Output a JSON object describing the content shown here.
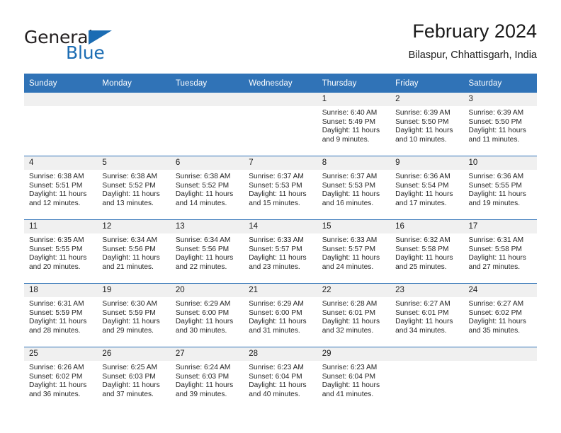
{
  "brand": {
    "name_top": "General",
    "name_bottom": "Blue",
    "accent_color": "#1b6cb3"
  },
  "header": {
    "title": "February 2024",
    "location": "Bilaspur, Chhattisgarh, India"
  },
  "theme": {
    "header_blue": "#3073b7",
    "daynum_band": "#f0f0f0",
    "text": "#1a1a1a"
  },
  "calendar": {
    "weekdays": [
      "Sunday",
      "Monday",
      "Tuesday",
      "Wednesday",
      "Thursday",
      "Friday",
      "Saturday"
    ],
    "labels": {
      "sunrise": "Sunrise:",
      "sunset": "Sunset:",
      "daylight": "Daylight:"
    },
    "weeks": [
      [
        {
          "day": "",
          "empty": true
        },
        {
          "day": "",
          "empty": true
        },
        {
          "day": "",
          "empty": true
        },
        {
          "day": "",
          "empty": true
        },
        {
          "day": "1",
          "sunrise": "Sunrise: 6:40 AM",
          "sunset": "Sunset: 5:49 PM",
          "daylight1": "Daylight: 11 hours",
          "daylight2": "and 9 minutes."
        },
        {
          "day": "2",
          "sunrise": "Sunrise: 6:39 AM",
          "sunset": "Sunset: 5:50 PM",
          "daylight1": "Daylight: 11 hours",
          "daylight2": "and 10 minutes."
        },
        {
          "day": "3",
          "sunrise": "Sunrise: 6:39 AM",
          "sunset": "Sunset: 5:50 PM",
          "daylight1": "Daylight: 11 hours",
          "daylight2": "and 11 minutes."
        }
      ],
      [
        {
          "day": "4",
          "sunrise": "Sunrise: 6:38 AM",
          "sunset": "Sunset: 5:51 PM",
          "daylight1": "Daylight: 11 hours",
          "daylight2": "and 12 minutes."
        },
        {
          "day": "5",
          "sunrise": "Sunrise: 6:38 AM",
          "sunset": "Sunset: 5:52 PM",
          "daylight1": "Daylight: 11 hours",
          "daylight2": "and 13 minutes."
        },
        {
          "day": "6",
          "sunrise": "Sunrise: 6:38 AM",
          "sunset": "Sunset: 5:52 PM",
          "daylight1": "Daylight: 11 hours",
          "daylight2": "and 14 minutes."
        },
        {
          "day": "7",
          "sunrise": "Sunrise: 6:37 AM",
          "sunset": "Sunset: 5:53 PM",
          "daylight1": "Daylight: 11 hours",
          "daylight2": "and 15 minutes."
        },
        {
          "day": "8",
          "sunrise": "Sunrise: 6:37 AM",
          "sunset": "Sunset: 5:53 PM",
          "daylight1": "Daylight: 11 hours",
          "daylight2": "and 16 minutes."
        },
        {
          "day": "9",
          "sunrise": "Sunrise: 6:36 AM",
          "sunset": "Sunset: 5:54 PM",
          "daylight1": "Daylight: 11 hours",
          "daylight2": "and 17 minutes."
        },
        {
          "day": "10",
          "sunrise": "Sunrise: 6:36 AM",
          "sunset": "Sunset: 5:55 PM",
          "daylight1": "Daylight: 11 hours",
          "daylight2": "and 19 minutes."
        }
      ],
      [
        {
          "day": "11",
          "sunrise": "Sunrise: 6:35 AM",
          "sunset": "Sunset: 5:55 PM",
          "daylight1": "Daylight: 11 hours",
          "daylight2": "and 20 minutes."
        },
        {
          "day": "12",
          "sunrise": "Sunrise: 6:34 AM",
          "sunset": "Sunset: 5:56 PM",
          "daylight1": "Daylight: 11 hours",
          "daylight2": "and 21 minutes."
        },
        {
          "day": "13",
          "sunrise": "Sunrise: 6:34 AM",
          "sunset": "Sunset: 5:56 PM",
          "daylight1": "Daylight: 11 hours",
          "daylight2": "and 22 minutes."
        },
        {
          "day": "14",
          "sunrise": "Sunrise: 6:33 AM",
          "sunset": "Sunset: 5:57 PM",
          "daylight1": "Daylight: 11 hours",
          "daylight2": "and 23 minutes."
        },
        {
          "day": "15",
          "sunrise": "Sunrise: 6:33 AM",
          "sunset": "Sunset: 5:57 PM",
          "daylight1": "Daylight: 11 hours",
          "daylight2": "and 24 minutes."
        },
        {
          "day": "16",
          "sunrise": "Sunrise: 6:32 AM",
          "sunset": "Sunset: 5:58 PM",
          "daylight1": "Daylight: 11 hours",
          "daylight2": "and 25 minutes."
        },
        {
          "day": "17",
          "sunrise": "Sunrise: 6:31 AM",
          "sunset": "Sunset: 5:58 PM",
          "daylight1": "Daylight: 11 hours",
          "daylight2": "and 27 minutes."
        }
      ],
      [
        {
          "day": "18",
          "sunrise": "Sunrise: 6:31 AM",
          "sunset": "Sunset: 5:59 PM",
          "daylight1": "Daylight: 11 hours",
          "daylight2": "and 28 minutes."
        },
        {
          "day": "19",
          "sunrise": "Sunrise: 6:30 AM",
          "sunset": "Sunset: 5:59 PM",
          "daylight1": "Daylight: 11 hours",
          "daylight2": "and 29 minutes."
        },
        {
          "day": "20",
          "sunrise": "Sunrise: 6:29 AM",
          "sunset": "Sunset: 6:00 PM",
          "daylight1": "Daylight: 11 hours",
          "daylight2": "and 30 minutes."
        },
        {
          "day": "21",
          "sunrise": "Sunrise: 6:29 AM",
          "sunset": "Sunset: 6:00 PM",
          "daylight1": "Daylight: 11 hours",
          "daylight2": "and 31 minutes."
        },
        {
          "day": "22",
          "sunrise": "Sunrise: 6:28 AM",
          "sunset": "Sunset: 6:01 PM",
          "daylight1": "Daylight: 11 hours",
          "daylight2": "and 32 minutes."
        },
        {
          "day": "23",
          "sunrise": "Sunrise: 6:27 AM",
          "sunset": "Sunset: 6:01 PM",
          "daylight1": "Daylight: 11 hours",
          "daylight2": "and 34 minutes."
        },
        {
          "day": "24",
          "sunrise": "Sunrise: 6:27 AM",
          "sunset": "Sunset: 6:02 PM",
          "daylight1": "Daylight: 11 hours",
          "daylight2": "and 35 minutes."
        }
      ],
      [
        {
          "day": "25",
          "sunrise": "Sunrise: 6:26 AM",
          "sunset": "Sunset: 6:02 PM",
          "daylight1": "Daylight: 11 hours",
          "daylight2": "and 36 minutes."
        },
        {
          "day": "26",
          "sunrise": "Sunrise: 6:25 AM",
          "sunset": "Sunset: 6:03 PM",
          "daylight1": "Daylight: 11 hours",
          "daylight2": "and 37 minutes."
        },
        {
          "day": "27",
          "sunrise": "Sunrise: 6:24 AM",
          "sunset": "Sunset: 6:03 PM",
          "daylight1": "Daylight: 11 hours",
          "daylight2": "and 39 minutes."
        },
        {
          "day": "28",
          "sunrise": "Sunrise: 6:23 AM",
          "sunset": "Sunset: 6:04 PM",
          "daylight1": "Daylight: 11 hours",
          "daylight2": "and 40 minutes."
        },
        {
          "day": "29",
          "sunrise": "Sunrise: 6:23 AM",
          "sunset": "Sunset: 6:04 PM",
          "daylight1": "Daylight: 11 hours",
          "daylight2": "and 41 minutes."
        },
        {
          "day": "",
          "empty": true
        },
        {
          "day": "",
          "empty": true
        }
      ]
    ]
  }
}
